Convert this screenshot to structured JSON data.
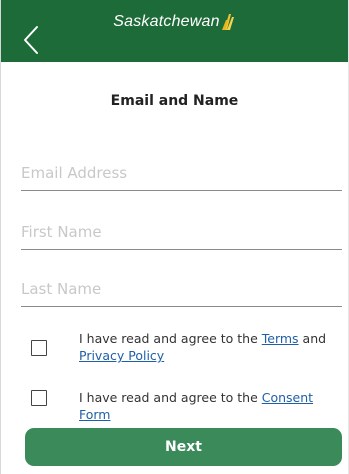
{
  "header": {
    "brand": "Saskatchewan",
    "background_color": "#1e6b3a",
    "back_icon": "chevron-left-icon",
    "brand_icon": "wheat-sheaf-logo"
  },
  "page": {
    "title": "Email and Name"
  },
  "form": {
    "email_placeholder": "Email Address",
    "first_name_placeholder": "First Name",
    "last_name_placeholder": "Last Name"
  },
  "agreements": {
    "terms": {
      "prefix": "I have read and agree to the ",
      "terms_link": "Terms",
      "conjunction": " and ",
      "privacy_link": "Privacy Policy"
    },
    "consent": {
      "prefix": "I have read and agree to the ",
      "consent_link": "Consent Form"
    }
  },
  "actions": {
    "next_label": "Next",
    "next_color": "#3b8a5a"
  },
  "colors": {
    "link": "#1f5fa8"
  }
}
